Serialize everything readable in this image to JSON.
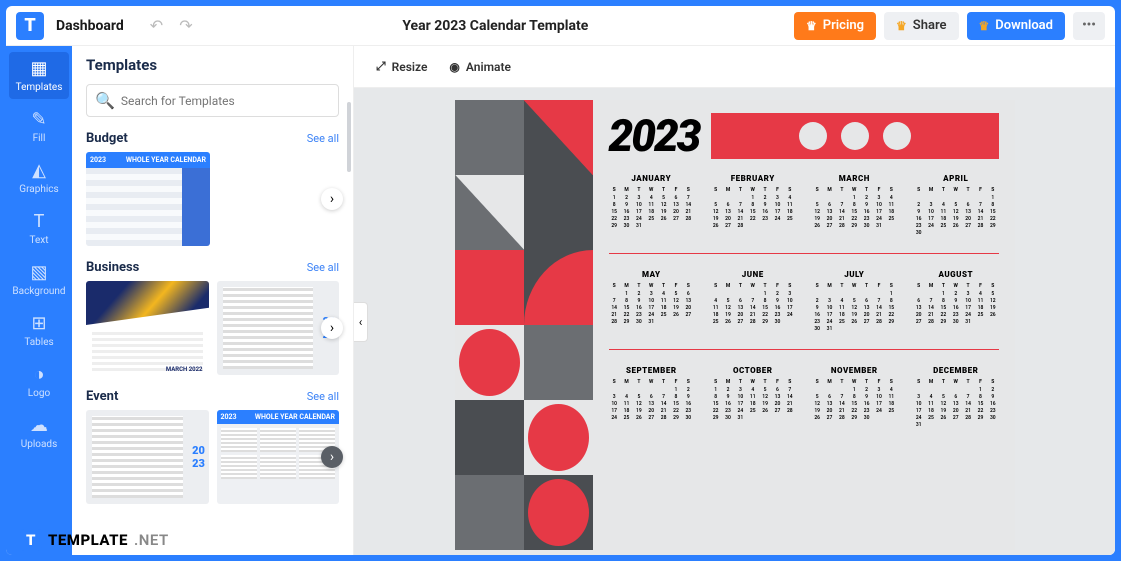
{
  "topbar": {
    "logo_letter": "T",
    "dashboard": "Dashboard",
    "doc_title": "Year 2023 Calendar Template",
    "pricing": "Pricing",
    "share": "Share",
    "download": "Download"
  },
  "nav": {
    "templates": "Templates",
    "fill": "Fill",
    "graphics": "Graphics",
    "text": "Text",
    "background": "Background",
    "tables": "Tables",
    "logo": "Logo",
    "uploads": "Uploads"
  },
  "panel": {
    "title": "Templates",
    "search_placeholder": "Search for Templates",
    "see_all": "See all",
    "categories": {
      "budget": "Budget",
      "business": "Business",
      "event": "Event"
    },
    "thumb_year": "2023",
    "thumb_whole": "WHOLE YEAR CALENDAR",
    "thumb_march": "MARCH  2022",
    "thumb_20": "20",
    "thumb_23": "23"
  },
  "tools": {
    "resize": "Resize",
    "animate": "Animate"
  },
  "calendar": {
    "year": "2023",
    "dow": [
      "S",
      "M",
      "T",
      "W",
      "T",
      "F",
      "S"
    ],
    "months": [
      {
        "name": "JANUARY",
        "start": 0,
        "days": 31
      },
      {
        "name": "FEBRUARY",
        "start": 3,
        "days": 28
      },
      {
        "name": "MARCH",
        "start": 3,
        "days": 31
      },
      {
        "name": "APRIL",
        "start": 6,
        "days": 30
      },
      {
        "name": "MAY",
        "start": 1,
        "days": 31
      },
      {
        "name": "JUNE",
        "start": 4,
        "days": 30
      },
      {
        "name": "JULY",
        "start": 6,
        "days": 31
      },
      {
        "name": "AUGUST",
        "start": 2,
        "days": 31
      },
      {
        "name": "SEPTEMBER",
        "start": 5,
        "days": 30
      },
      {
        "name": "OCTOBER",
        "start": 0,
        "days": 31
      },
      {
        "name": "NOVEMBER",
        "start": 3,
        "days": 30
      },
      {
        "name": "DECEMBER",
        "start": 5,
        "days": 31
      }
    ]
  },
  "watermark": {
    "logo": "T",
    "brand": "TEMPLATE",
    "suffix": ".NET"
  }
}
